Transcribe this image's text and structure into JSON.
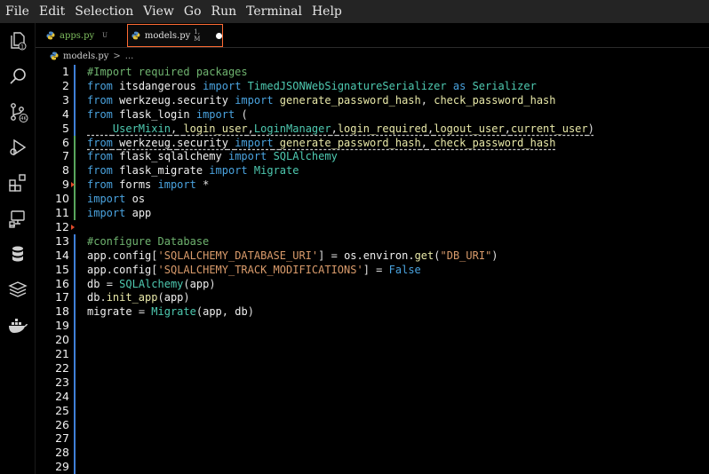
{
  "menubar": {
    "items": [
      "File",
      "Edit",
      "Selection",
      "View",
      "Go",
      "Run",
      "Terminal",
      "Help"
    ]
  },
  "activitybar": {
    "icons": [
      "explorer-icon",
      "search-icon",
      "source-control-icon",
      "run-debug-icon",
      "extensions-icon",
      "remote-explorer-icon",
      "database-icon",
      "layers-icon",
      "docker-icon"
    ],
    "badges": {
      "explorer": "1",
      "source_control": "4K"
    }
  },
  "tabs": [
    {
      "label": "apps.py",
      "status": "U",
      "active": false
    },
    {
      "label": "models.py",
      "status": "1, M",
      "active": true,
      "dirty": true
    }
  ],
  "breadcrumb": {
    "file": "models.py",
    "sep": ">",
    "more": "..."
  },
  "colors": {
    "accent": "#ff6b33",
    "keyword": "#4aa3df",
    "comment": "#6fb36f",
    "string": "#d99b6b",
    "class": "#4ec9b0",
    "modified_bar": "#3f7fd8",
    "added_bar": "#58a65c"
  },
  "editor": {
    "line_numbers": [
      "1",
      "2",
      "3",
      "4",
      "5",
      "6",
      "7",
      "8",
      "9",
      "10",
      "11",
      "12",
      "13",
      "14",
      "15",
      "16",
      "17",
      "18",
      "19",
      "20",
      "21",
      "22",
      "23",
      "24",
      "25",
      "26",
      "27",
      "28",
      "29"
    ],
    "lines": [
      "#Import required packages",
      "from itsdangerous import TimedJSONWebSignatureSerializer as Serializer",
      "from werkzeug.security import generate_password_hash, check_password_hash",
      "from flask_login import (",
      "    UserMixin, login_user,LoginManager,login_required,logout_user,current_user)",
      "from werkzeug.security import generate_password_hash, check_password_hash",
      "from flask_sqlalchemy import SQLAlchemy",
      "from flask_migrate import Migrate",
      "from forms import *",
      "import os",
      "import app",
      "",
      "#configure Database",
      "app.config['SQLALCHEMY_DATABASE_URI'] = os.environ.get(\"DB_URI\")",
      "app.config['SQLALCHEMY_TRACK_MODIFICATIONS'] = False",
      "db = SQLAlchemy(app)",
      "db.init_app(app)",
      "migrate = Migrate(app, db)"
    ]
  }
}
